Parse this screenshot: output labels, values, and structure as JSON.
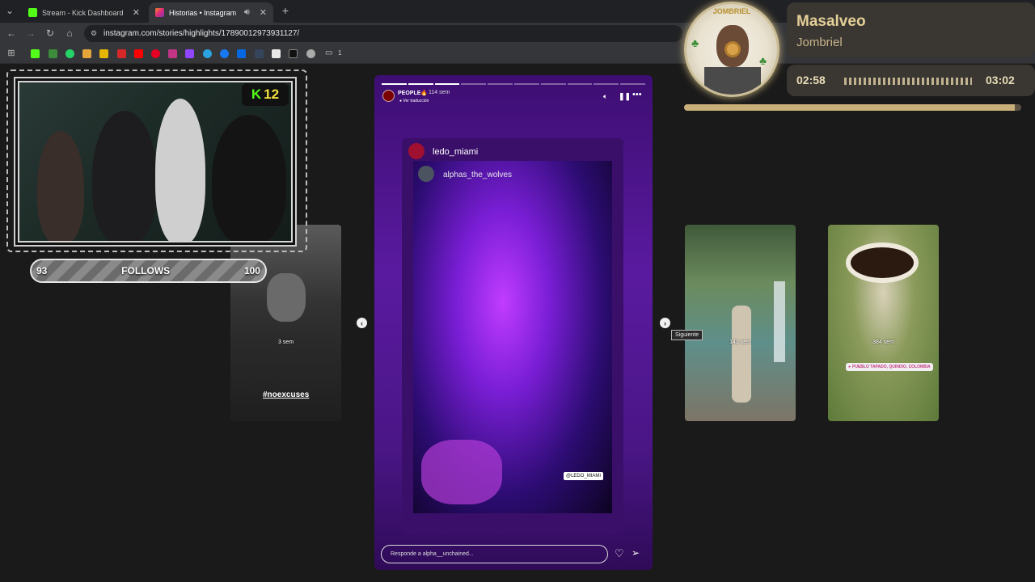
{
  "browser": {
    "tabs": [
      {
        "title": "Stream - Kick Dashboard",
        "favicon_color": "#53fc18",
        "active": false
      },
      {
        "title": "Historias • Instagram",
        "favicon_color": "#d6287b",
        "active": true
      }
    ],
    "new_tab": "+",
    "url": "instagram.com/stories/highlights/17890012973931127/",
    "bookmarks_folder_count": "1"
  },
  "overlay": {
    "kick_badge": {
      "letter": "K",
      "count": "12"
    },
    "follows": {
      "current": "93",
      "label": "FOLLOWS",
      "goal": "100"
    },
    "webcam_label": "Webcam feed"
  },
  "stories": {
    "main": {
      "account": "PEOPLE🔥",
      "time": "114 sem",
      "translate": "Ver traducción",
      "post_user": "ledo_miami",
      "tagged_user": "alphas_the_wolves",
      "mention_tag": "@LEDO_MIAMI",
      "reply_placeholder": "Responde a alpha__unchained...",
      "progress_done": 3,
      "progress_total": 10
    },
    "prev": {
      "time": "3 sem",
      "hashtag": "#noexcuses"
    },
    "next": [
      {
        "time": "141 sem"
      },
      {
        "time": "384 sem",
        "location": "PUEBLO TAPADO, QUINDIO, COLOMBIA"
      }
    ],
    "tooltip_next": "Siguiente"
  },
  "music": {
    "title": "Masalveo",
    "artist": "Jombriel",
    "elapsed": "02:58",
    "duration": "03:02",
    "album_text": "JOMBRIEL",
    "progress": 0.98
  }
}
